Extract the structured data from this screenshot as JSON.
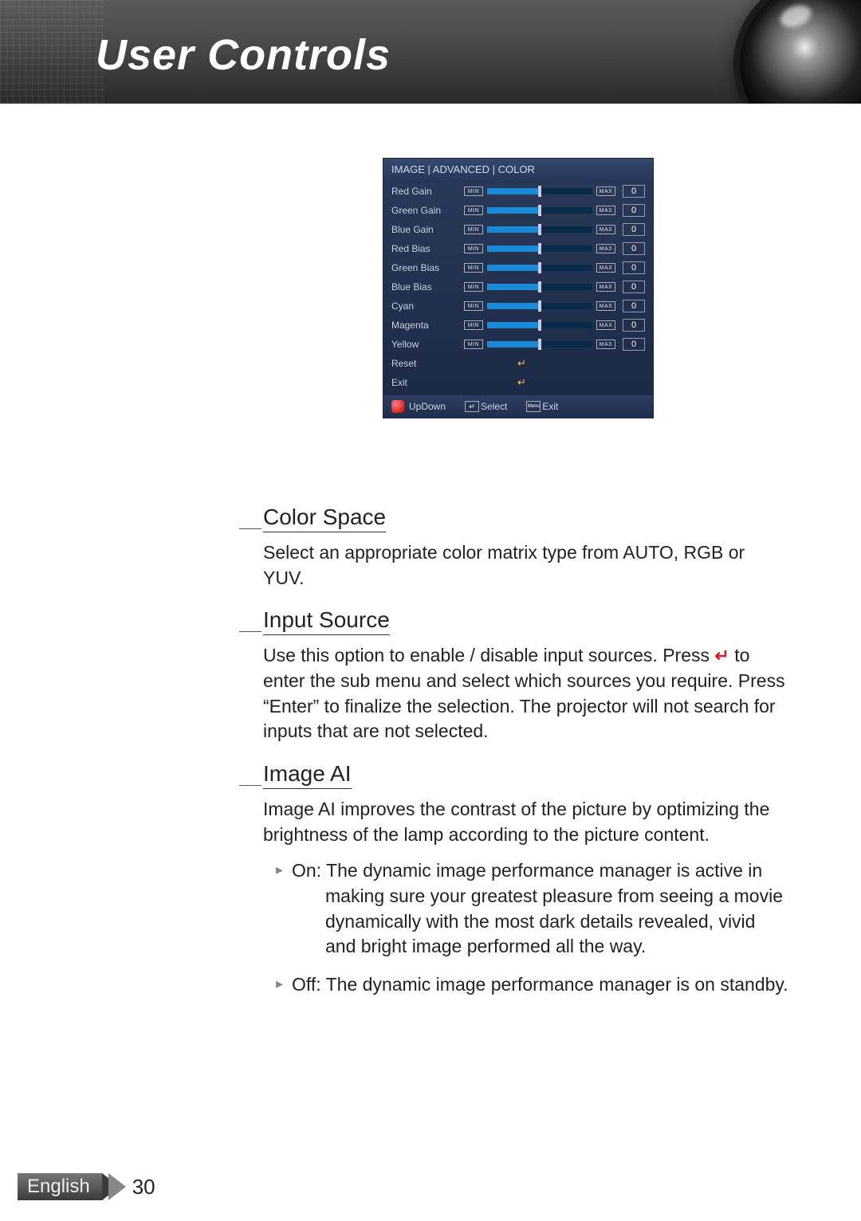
{
  "header": {
    "title": "User Controls"
  },
  "osd": {
    "title": "IMAGE | ADVANCED | COLOR",
    "min_label": "MIN",
    "max_label": "MAX",
    "rows": [
      {
        "label": "Red Gain",
        "value": "0"
      },
      {
        "label": "Green Gain",
        "value": "0"
      },
      {
        "label": "Blue Gain",
        "value": "0"
      },
      {
        "label": "Red Bias",
        "value": "0"
      },
      {
        "label": "Green Bias",
        "value": "0"
      },
      {
        "label": "Blue Bias",
        "value": "0"
      },
      {
        "label": "Cyan",
        "value": "0"
      },
      {
        "label": "Magenta",
        "value": "0"
      },
      {
        "label": "Yellow",
        "value": "0"
      }
    ],
    "reset_label": "Reset",
    "exit_label": "Exit",
    "footer": {
      "updown": "UpDown",
      "select": "Select",
      "menu_label": "Menu",
      "exit": "Exit"
    }
  },
  "sections": {
    "color_space": {
      "title": "Color Space",
      "body": "Select an appropriate color matrix type from AUTO, RGB or YUV."
    },
    "input_source": {
      "title": "Input Source",
      "body_pre": "Use this option to enable / disable input sources. Press ",
      "body_post": " to enter the sub menu and select which sources you require. Press “Enter” to finalize the selection. The projector will not search for inputs that are not selected."
    },
    "image_ai": {
      "title": "Image AI",
      "body": "Image AI improves the contrast of the picture by optimizing the brightness of the lamp according to the picture content.",
      "bullets": [
        {
          "head": "On:",
          "rest": " The dynamic image performance manager is active in",
          "cont": "making sure your greatest pleasure from seeing a movie dynamically with the most dark details revealed, vivid and bright image performed all the way."
        },
        {
          "head": "Off:",
          "rest": " The dynamic image performance manager is on standby.",
          "cont": ""
        }
      ]
    }
  },
  "footer": {
    "language": "English",
    "page": "30"
  }
}
